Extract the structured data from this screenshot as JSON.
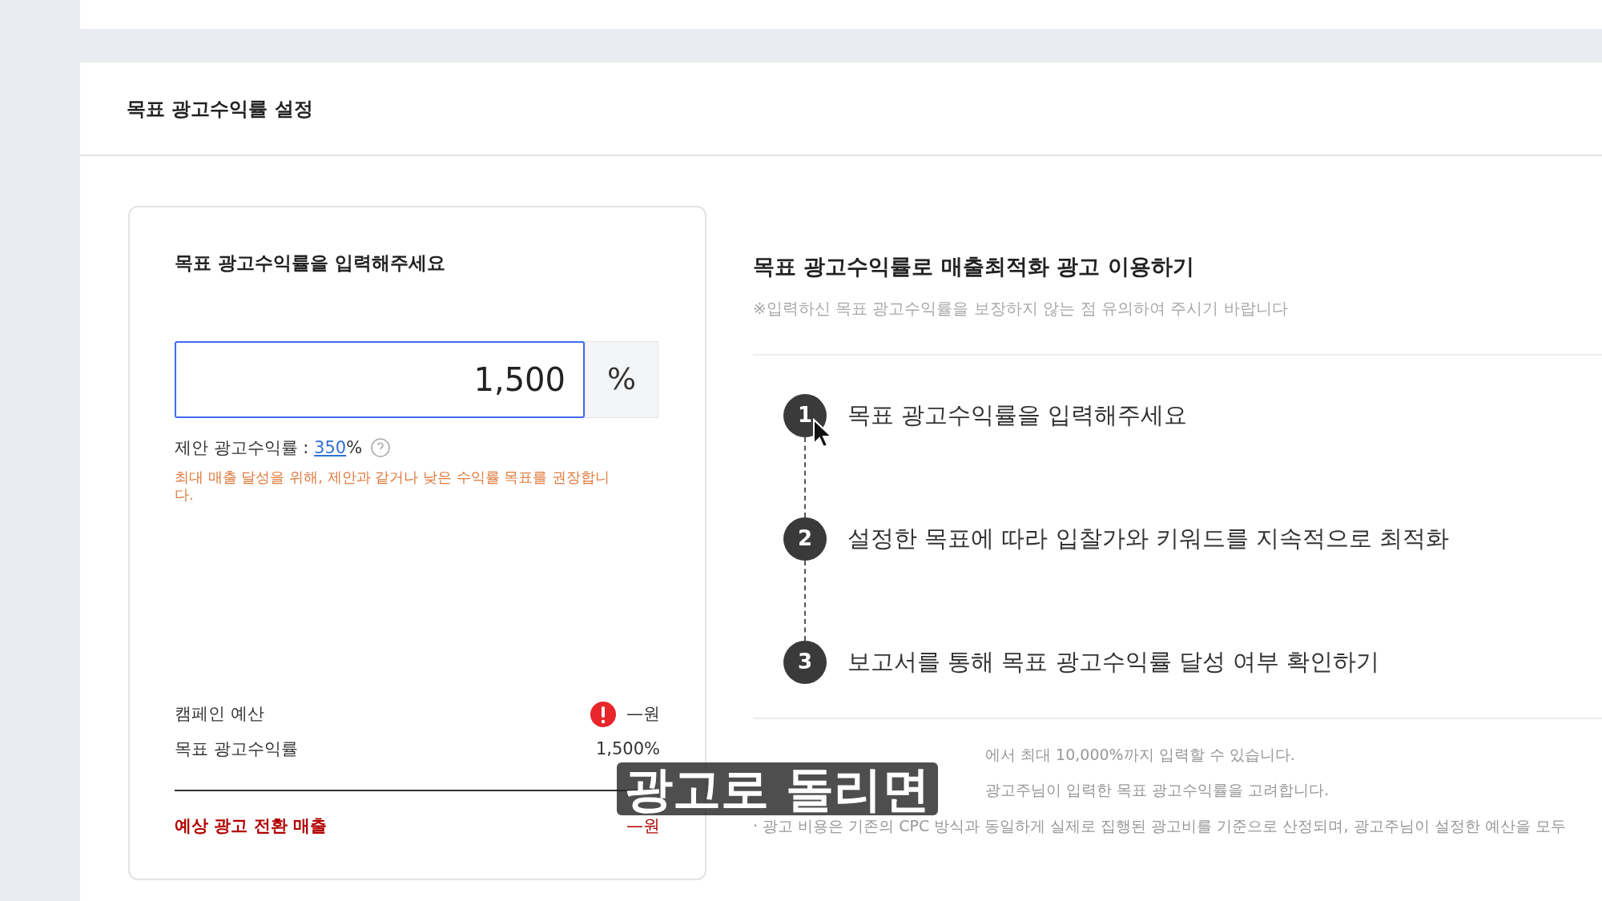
{
  "section_title": "목표 광고수익률 설정",
  "input_card": {
    "title": "목표 광고수익률을 입력해주세요",
    "value": "1,500",
    "unit": "%",
    "suggestion_label": "제안 광고수익률 : ",
    "suggestion_value": "350",
    "suggestion_unit": "%",
    "warning": "최대 매출 달성을 위해, 제안과 같거나 낮은 수익률 목표를 권장합니다.",
    "summary": [
      {
        "label": "캠페인 예산",
        "value": "—원",
        "alert": true
      },
      {
        "label": "목표 광고수익률",
        "value": "1,500%",
        "alert": false
      }
    ],
    "total": {
      "label": "예상 광고 전환 매출",
      "value": "—원"
    }
  },
  "guide": {
    "title": "목표 광고수익률로 매출최적화 광고 이용하기",
    "notice": "※입력하신 목표 광고수익률을 보장하지 않는 점 유의하여 주시기 바랍니다",
    "steps": [
      {
        "number": "1",
        "text": "목표 광고수익률을 입력해주세요"
      },
      {
        "number": "2",
        "text": "설정한 목표에 따라 입찰가와 키워드를 지속적으로 최적화"
      },
      {
        "number": "3",
        "text": "보고서를 통해 목표 광고수익률 달성 여부 확인하기"
      }
    ],
    "notes": [
      "에서 최대 10,000%까지 입력할 수 있습니다.",
      "광고주님이 입력한 목표 광고수익률을 고려합니다.",
      "· 광고 비용은 기존의 CPC 방식과 동일하게 실제로 집행된 광고비를 기준으로 산정되며, 광고주님이 설정한 예산을 모두"
    ]
  },
  "caption": "광고로 돌리면"
}
